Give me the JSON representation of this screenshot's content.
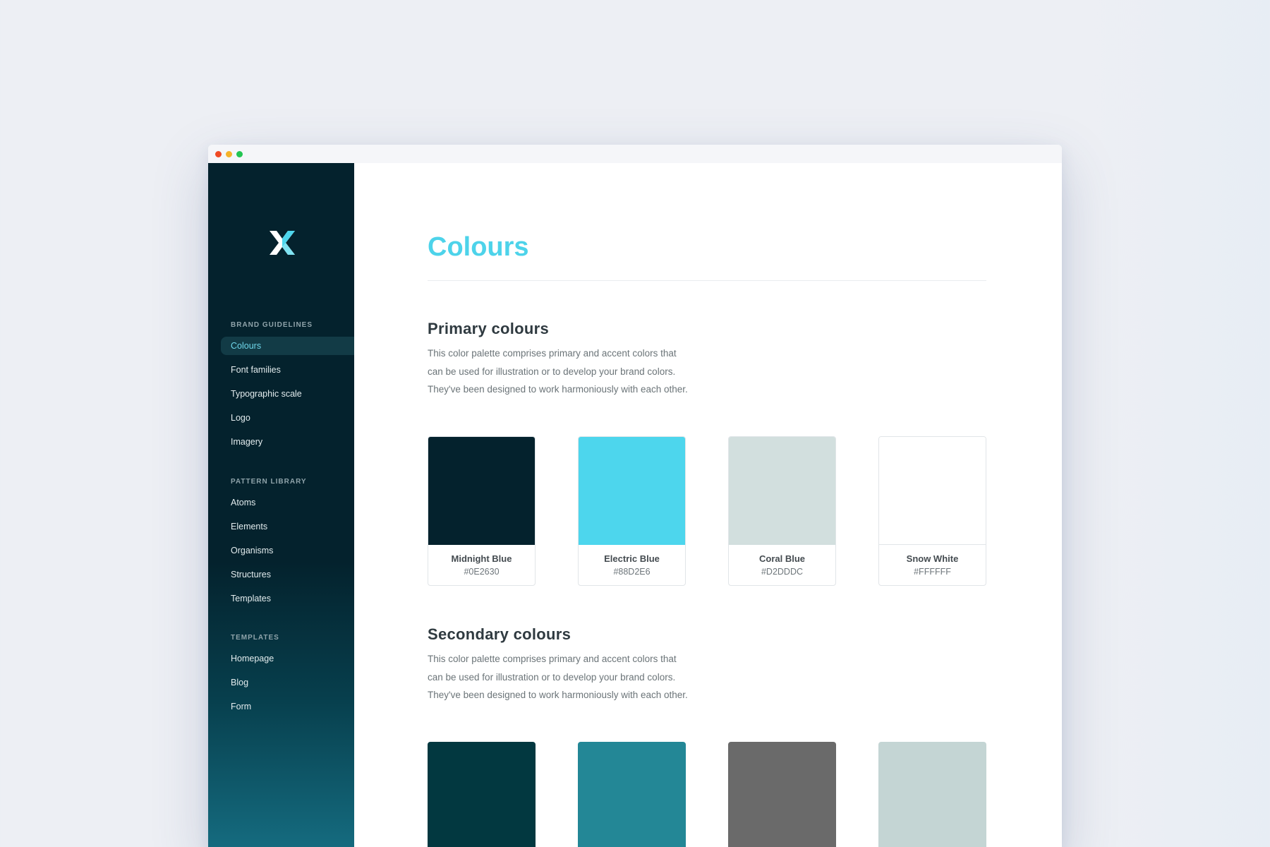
{
  "window": {
    "controls": [
      {
        "name": "close",
        "color": "#f04a24"
      },
      {
        "name": "minimize",
        "color": "#f5b32a"
      },
      {
        "name": "maximize",
        "color": "#23c552"
      }
    ]
  },
  "sidebar": {
    "logo": "x-logo",
    "groups": [
      {
        "heading": "BRAND GUIDELINES",
        "items": [
          "Colours",
          "Font families",
          "Typographic scale",
          "Logo",
          "Imagery"
        ]
      },
      {
        "heading": "PATTERN LIBRARY",
        "items": [
          "Atoms",
          "Elements",
          "Organisms",
          "Structures",
          "Templates"
        ]
      },
      {
        "heading": "TEMPLATES",
        "items": [
          "Homepage",
          "Blog",
          "Form"
        ]
      }
    ],
    "active_item": "Colours"
  },
  "main": {
    "title": "Colours",
    "primary": {
      "title": "Primary colours",
      "desc": [
        "This color palette comprises primary and accent colors that",
        "can be used for illustration or to develop your brand colors.",
        "They've been designed to work harmoniously with each other."
      ],
      "swatches": [
        {
          "name": "Midnight Blue",
          "hex": "#0E2630",
          "color": "#04222d"
        },
        {
          "name": "Electric Blue",
          "hex": "#88D2E6",
          "color": "#4dd6ed"
        },
        {
          "name": "Coral Blue",
          "hex": "#D2DDDC",
          "color": "#d2dfde"
        },
        {
          "name": "Snow White",
          "hex": "#FFFFFF",
          "color": "#ffffff"
        }
      ]
    },
    "secondary": {
      "title": "Secondary colours",
      "desc": [
        "This color palette comprises primary and accent colors that",
        "can be used for illustration or to develop your brand colors.",
        "They've been designed to work harmoniously with each other."
      ],
      "swatches": [
        {
          "color": "#023840"
        },
        {
          "color": "#238796"
        },
        {
          "color": "#6a6a6a"
        },
        {
          "color": "#c4d5d4"
        }
      ]
    }
  }
}
